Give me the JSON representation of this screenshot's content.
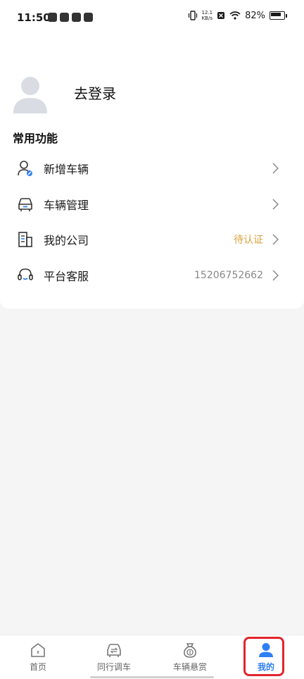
{
  "status_bar": {
    "time": "11:50",
    "net_speed_value": "12.1",
    "net_speed_unit": "KB/s",
    "battery_percent": "82%"
  },
  "profile": {
    "login_label": "去登录"
  },
  "section": {
    "title": "常用功能"
  },
  "menu": {
    "items": [
      {
        "label": "新增车辆",
        "icon": "add-user-icon"
      },
      {
        "label": "车辆管理",
        "icon": "car-icon"
      },
      {
        "label": "我的公司",
        "value": "待认证",
        "icon": "building-icon"
      },
      {
        "label": "平台客服",
        "value": "15206752662",
        "icon": "headset-icon"
      }
    ]
  },
  "tabs": [
    {
      "label": "首页",
      "icon": "home-icon"
    },
    {
      "label": "同行调车",
      "icon": "car-swap-icon"
    },
    {
      "label": "车辆悬赏",
      "icon": "money-bag-icon"
    },
    {
      "label": "我的",
      "icon": "user-icon",
      "active": true
    }
  ],
  "colors": {
    "accent": "#2f7ef5",
    "pending": "#d8a23a",
    "highlight": "#e0262d"
  }
}
